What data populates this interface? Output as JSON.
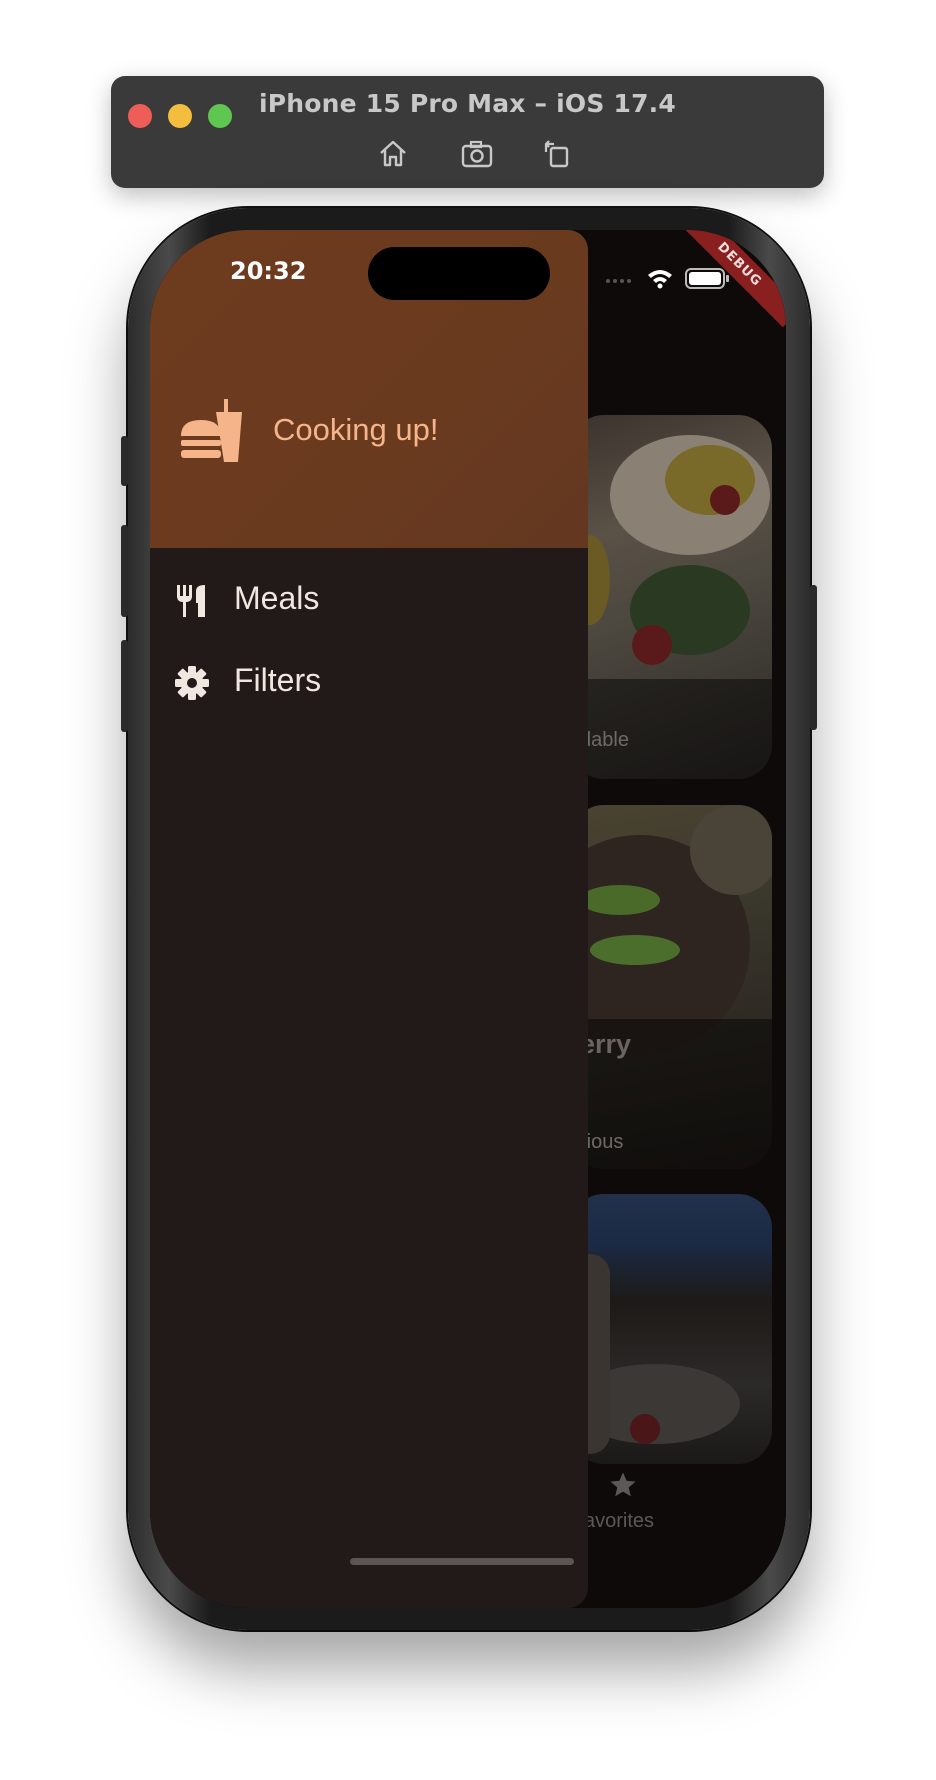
{
  "simulator": {
    "title": "iPhone 15 Pro Max – iOS 17.4",
    "tools": [
      {
        "icon": "home-icon"
      },
      {
        "icon": "screenshot-icon"
      },
      {
        "icon": "rotate-icon"
      }
    ]
  },
  "status_bar": {
    "time": "20:32",
    "debug_banner": "DEBUG"
  },
  "drawer": {
    "header_title": "Cooking up!",
    "header_icon": "fastfood-icon",
    "items": [
      {
        "label": "Meals",
        "icon": "restaurant-icon"
      },
      {
        "label": "Filters",
        "icon": "settings-icon"
      }
    ]
  },
  "background_content": {
    "cards": [
      {
        "meta_fragment": "dable"
      },
      {
        "title_fragment": "erry",
        "meta_fragment": "rious"
      },
      {}
    ],
    "bottom_nav_label_fragment": "avorites"
  },
  "colors": {
    "drawer_header": "#6a3a1f",
    "drawer_background": "#221a18",
    "header_accent": "#f6b48a",
    "item_text": "#f1e7e1"
  }
}
